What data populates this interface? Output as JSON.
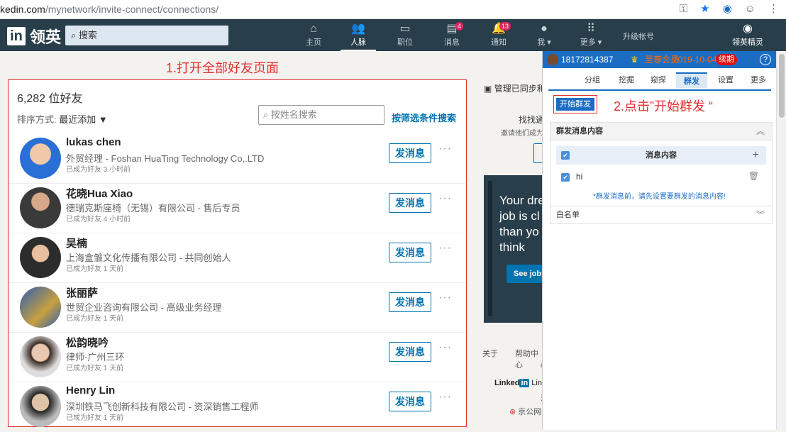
{
  "browser": {
    "url": "kedin.com",
    "url_path": "/mynetwork/invite-connect/connections/"
  },
  "nav": {
    "brand": "领英",
    "search_placeholder": "搜索",
    "items": [
      {
        "label": "主页",
        "icon": "home-icon"
      },
      {
        "label": "人脉",
        "icon": "people-icon"
      },
      {
        "label": "职位",
        "icon": "briefcase-icon"
      },
      {
        "label": "消息",
        "icon": "message-icon",
        "badge": "4"
      },
      {
        "label": "通知",
        "icon": "bell-icon",
        "badge": "13"
      },
      {
        "label": "我 ▾",
        "icon": "avatar"
      },
      {
        "label": "更多 ▾",
        "icon": "grid-icon"
      }
    ],
    "upgrade": "升级帐号",
    "extension": "领英精灵"
  },
  "annotation_1": "1.打开全部好友页面",
  "connections": {
    "count": "6,282 位好友",
    "sort_label": "排序方式:",
    "sort_value": "最近添加 ▼",
    "search_placeholder": "按姓名搜索",
    "filter_link": "按筛选条件搜索",
    "message_label": "发消息",
    "people": [
      {
        "name": "lukas chen",
        "title": "外贸经理 - Foshan HuaTing Technology Co,.LTD",
        "time": "已成为好友 3 小时前"
      },
      {
        "name": "花晓Hua Xiao",
        "title": "德瑞克斯座椅（无锡）有限公司 - 售后专员",
        "time": "已成为好友 4 小时前"
      },
      {
        "name": "吴楠",
        "title": "上海盒雏文化传播有限公司 - 共同创始人",
        "time": "已成为好友 1 天前"
      },
      {
        "name": "张丽萨",
        "title": "世贸企业咨询有限公司 - 高级业务经理",
        "time": "已成为好友 1 天前"
      },
      {
        "name": "松韵晓吟",
        "title": "律师-广州三环",
        "time": "已成为好友 1 天前"
      },
      {
        "name": "Henry Lin",
        "title": "深圳铁马飞创新科技有限公司 - 资深销售工程师",
        "time": "已成为好友 1 天前"
      }
    ]
  },
  "right_col": {
    "manage": "管理已同步和",
    "find": "找找通",
    "invite": "邀请他们成为",
    "ad_text": "Your dre\njob is cl\nthan yo\nthink",
    "ad_button": "See jobs",
    "footer_about": "关于",
    "footer_help": "帮助中心",
    "footer_i": "i",
    "footer_brand_a": "Linked",
    "footer_brand_b": "in",
    "footer_brand_c": "Lin",
    "footer_hu": "沪",
    "footer_icp": "京公网"
  },
  "panel": {
    "phone": "18172814387",
    "vip": "至尊会员",
    "date": "2019-10-04",
    "renew": "续期",
    "help": "?",
    "tabs": [
      "分组",
      "挖掘",
      "窥探",
      "群发",
      "设置",
      "更多"
    ],
    "active_tab": "群发",
    "start_button": "开始群发",
    "annotation_2": "2.点击”开始群发 “",
    "section_messages": "群发消息内容",
    "table_header": "消息内容",
    "message_row": "hi",
    "note": "*群发消息前，请先设置要群发的消息内容!",
    "section_whitelist": "白名单"
  }
}
